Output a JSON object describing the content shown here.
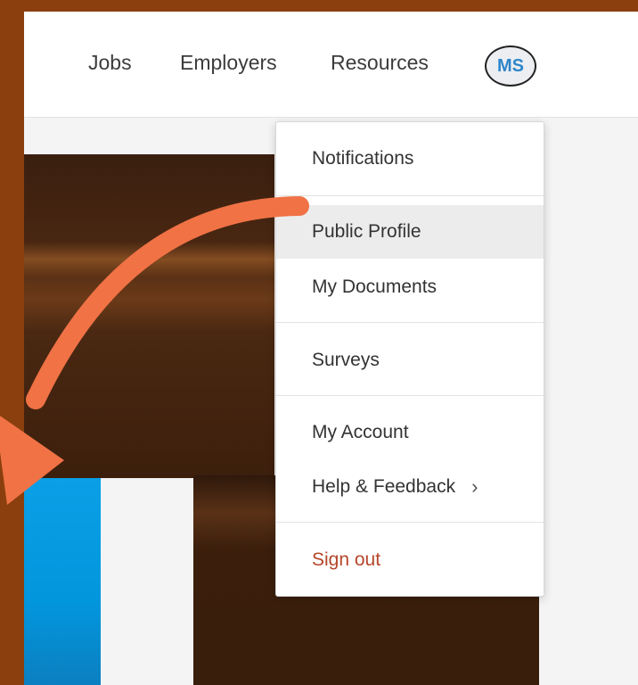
{
  "nav": {
    "links": [
      "Jobs",
      "Employers",
      "Resources"
    ],
    "avatar_initials": "MS"
  },
  "menu": {
    "items": [
      {
        "label": "Notifications"
      },
      {
        "label": "Public Profile",
        "active": true
      },
      {
        "label": "My Documents"
      },
      {
        "label": "Surveys"
      },
      {
        "label": "My Account"
      },
      {
        "label": "Help & Feedback",
        "chevron": "›"
      },
      {
        "label": "Sign out"
      }
    ]
  },
  "colors": {
    "frame": "#8b3f0f",
    "arrow": "#f07245",
    "accent_blue": "#0a9fe6",
    "signout": "#b5452a"
  },
  "icons": {
    "arrow": "annotation-arrow-icon",
    "chevron": "chevron-right-icon"
  }
}
